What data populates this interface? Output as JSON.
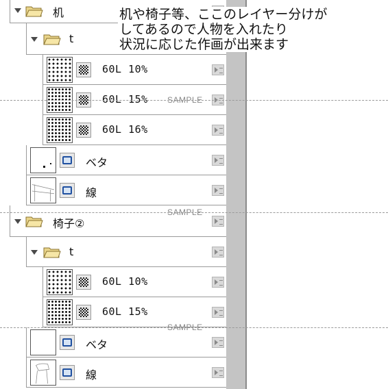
{
  "caption": {
    "line1": "机や椅子等、ここのレイヤー分けが",
    "line2": "してあるので人物を入れたり",
    "line3": "状況に応じた作画が出来ます"
  },
  "watermark": "SAMPLE",
  "layers": {
    "folder_desk": {
      "label": "机"
    },
    "folder_desk_t": {
      "label": "t"
    },
    "desk_tone1": {
      "label": "60L 10%"
    },
    "desk_tone2": {
      "label": "60L 15%"
    },
    "desk_tone3": {
      "label": "60L 16%"
    },
    "desk_beta": {
      "label": "ベタ"
    },
    "desk_line": {
      "label": "線"
    },
    "folder_chair": {
      "label": "椅子②"
    },
    "folder_chair_t": {
      "label": "t"
    },
    "chair_tone1": {
      "label": "60L 10%"
    },
    "chair_tone2": {
      "label": "60L 15%"
    },
    "chair_beta": {
      "label": "ベタ"
    },
    "chair_line": {
      "label": "線"
    }
  }
}
